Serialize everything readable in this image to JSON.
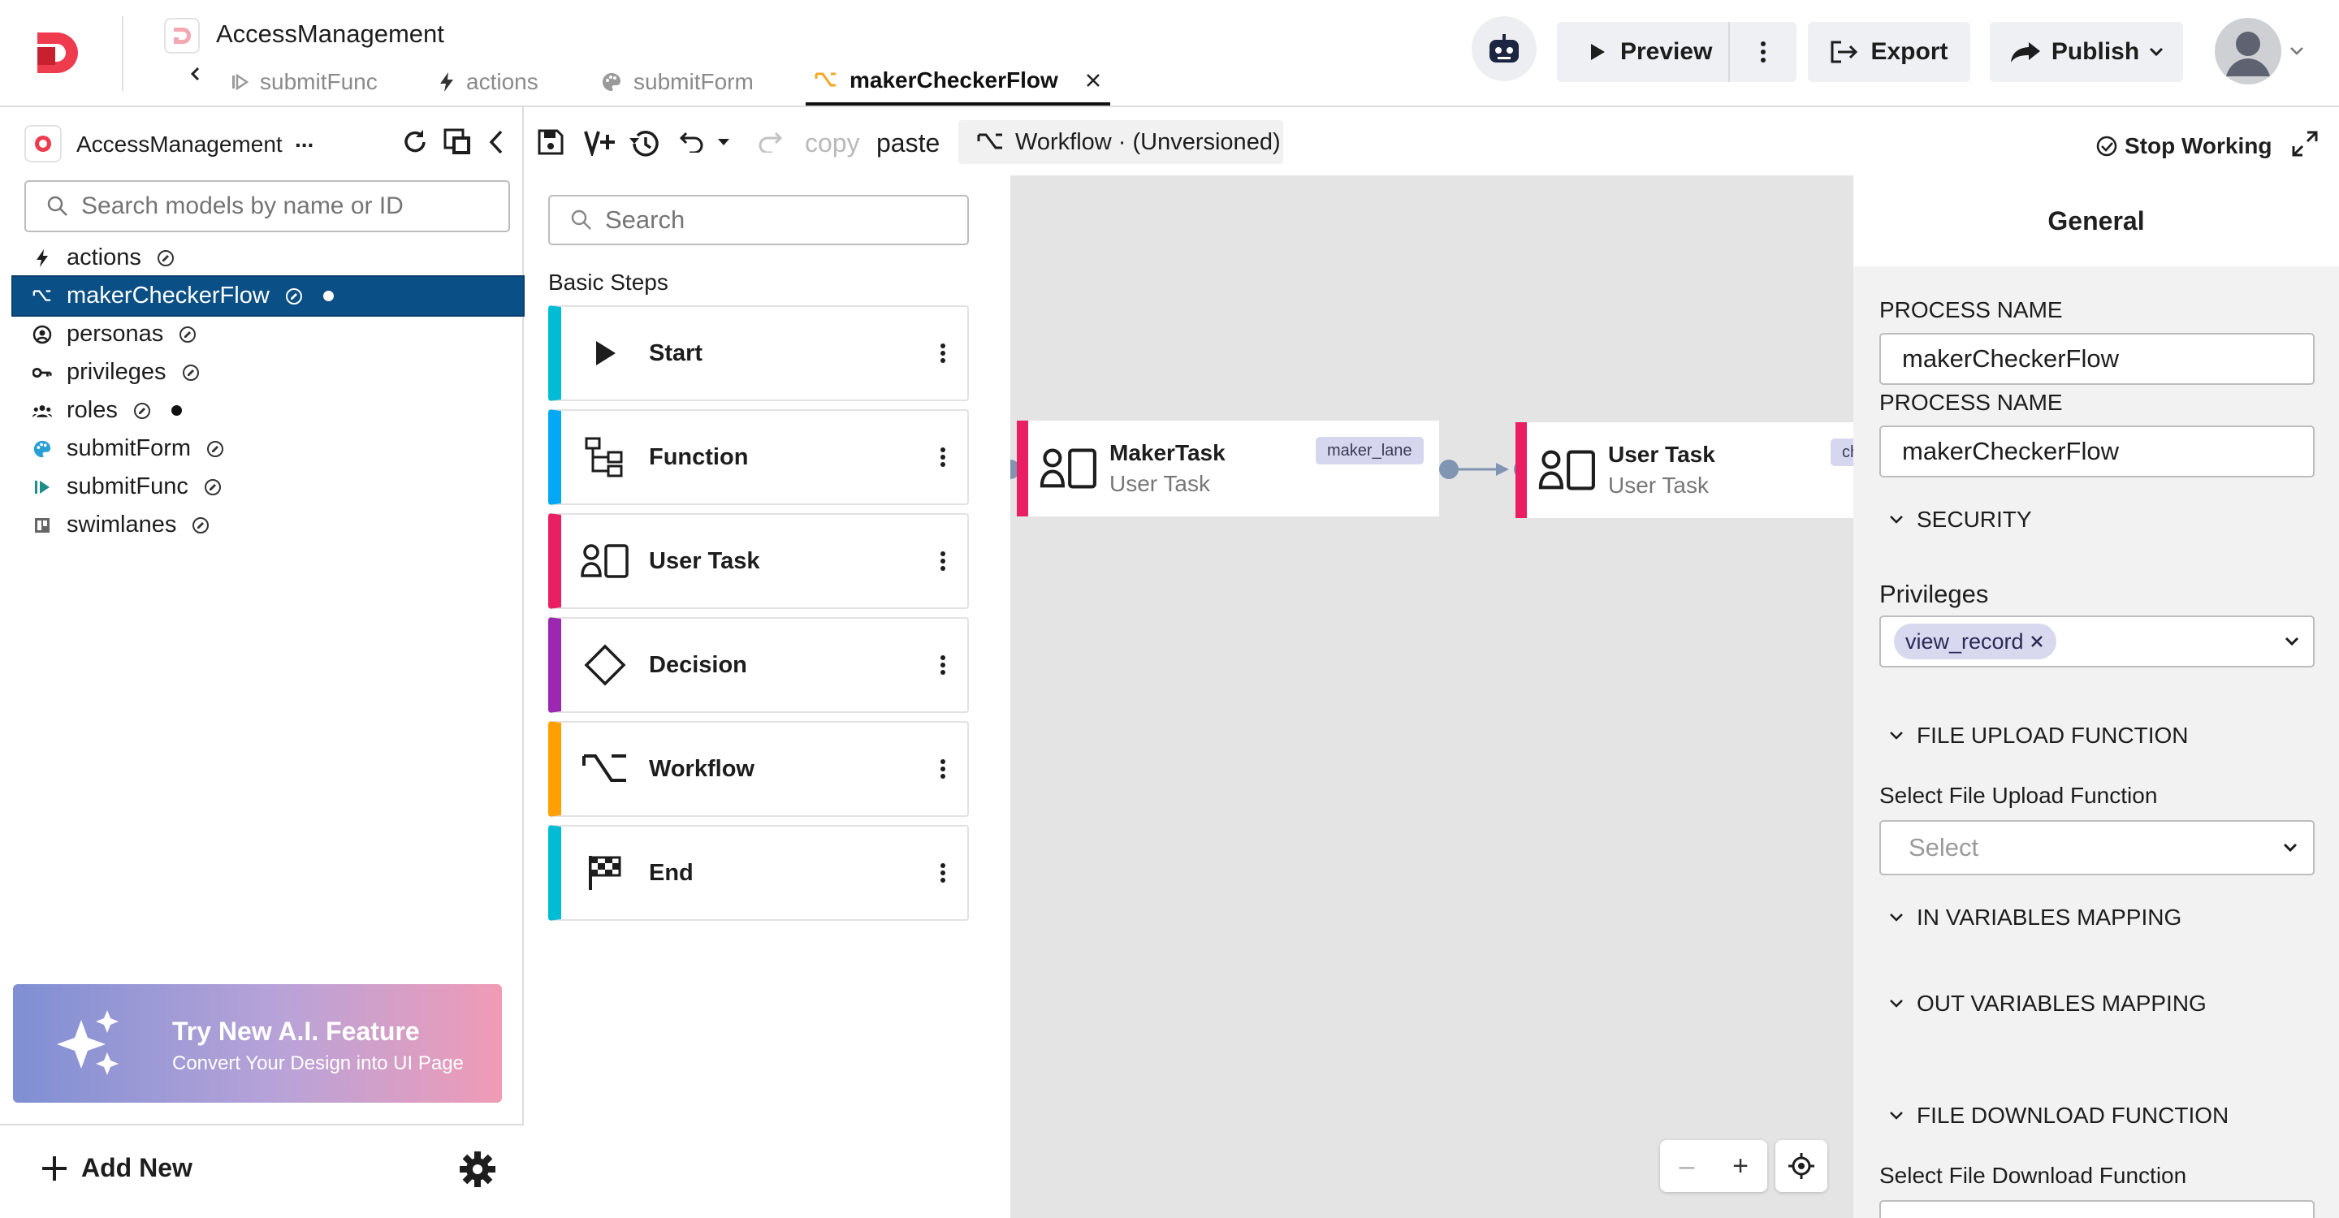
{
  "header": {
    "app_title": "AccessManagement",
    "tabs": [
      {
        "label": "submitFunc",
        "icon": "play-outline-icon",
        "active": false
      },
      {
        "label": "actions",
        "icon": "bolt-icon",
        "active": false
      },
      {
        "label": "submitForm",
        "icon": "palette-icon",
        "active": false
      },
      {
        "label": "makerCheckerFlow",
        "icon": "workflow-icon",
        "active": true
      }
    ],
    "preview_label": "Preview",
    "export_label": "Export",
    "publish_label": "Publish"
  },
  "sidebar": {
    "title": "AccessManagement",
    "more": "...",
    "search_placeholder": "Search models by name or ID",
    "items": [
      {
        "label": "actions",
        "icon": "bolt-icon",
        "selected": false,
        "unsaved": false
      },
      {
        "label": "makerCheckerFlow",
        "icon": "workflow-icon",
        "selected": true,
        "unsaved": true
      },
      {
        "label": "personas",
        "icon": "persona-icon",
        "selected": false,
        "unsaved": false
      },
      {
        "label": "privileges",
        "icon": "key-icon",
        "selected": false,
        "unsaved": false
      },
      {
        "label": "roles",
        "icon": "group-icon",
        "selected": false,
        "unsaved": true
      },
      {
        "label": "submitForm",
        "icon": "palette-icon",
        "selected": false,
        "unsaved": false
      },
      {
        "label": "submitFunc",
        "icon": "play-outline-icon",
        "selected": false,
        "unsaved": false
      },
      {
        "label": "swimlanes",
        "icon": "swimlane-icon",
        "selected": false,
        "unsaved": false
      }
    ],
    "ai_banner": {
      "title": "Try New A.I. Feature",
      "subtitle": "Convert Your Design into UI Page"
    },
    "add_new_label": "Add New"
  },
  "toolbar": {
    "copy_label": "copy",
    "paste_label": "paste",
    "workflow_label": "Workflow · (Unversioned)",
    "stop_working_label": "Stop Working"
  },
  "palette": {
    "search_placeholder": "Search",
    "heading": "Basic Steps",
    "steps": [
      {
        "label": "Start",
        "color": "#00bcd4",
        "icon": "play-icon"
      },
      {
        "label": "Function",
        "color": "#03a9f4",
        "icon": "function-icon"
      },
      {
        "label": "User Task",
        "color": "#e91e63",
        "icon": "user-task-icon"
      },
      {
        "label": "Decision",
        "color": "#9c27b0",
        "icon": "diamond-icon"
      },
      {
        "label": "Workflow",
        "color": "#ffa000",
        "icon": "workflow-icon"
      },
      {
        "label": "End",
        "color": "#00bcd4",
        "icon": "flag-icon"
      }
    ]
  },
  "canvas": {
    "nodes": [
      {
        "title": "MakerTask",
        "subtitle": "User Task",
        "lane": "maker_lane"
      },
      {
        "title": "User Task",
        "subtitle": "User Task",
        "lane": "chec"
      }
    ],
    "zoom_out": "–",
    "zoom_in": "+"
  },
  "properties": {
    "header": "General",
    "process_name_label": "PROCESS NAME",
    "process_name_value": "makerCheckerFlow",
    "process_name_label_2": "PROCESS NAME",
    "process_name_value_2": "makerCheckerFlow",
    "security_label": "SECURITY",
    "privileges_label": "Privileges",
    "privileges_chip": "view_record",
    "file_upload_label": "FILE UPLOAD FUNCTION",
    "select_upload_label": "Select File Upload Function",
    "select_placeholder": "Select",
    "in_vars_label": "IN VARIABLES MAPPING",
    "out_vars_label": "OUT VARIABLES MAPPING",
    "file_download_label": "FILE DOWNLOAD FUNCTION",
    "select_download_label": "Select File Download Function"
  },
  "colors": {
    "selected_item": "#0a4f85",
    "user_task_accent": "#e91e63",
    "tab_active_icon": "#f5a623",
    "chip_bg": "#d8d9ef"
  }
}
